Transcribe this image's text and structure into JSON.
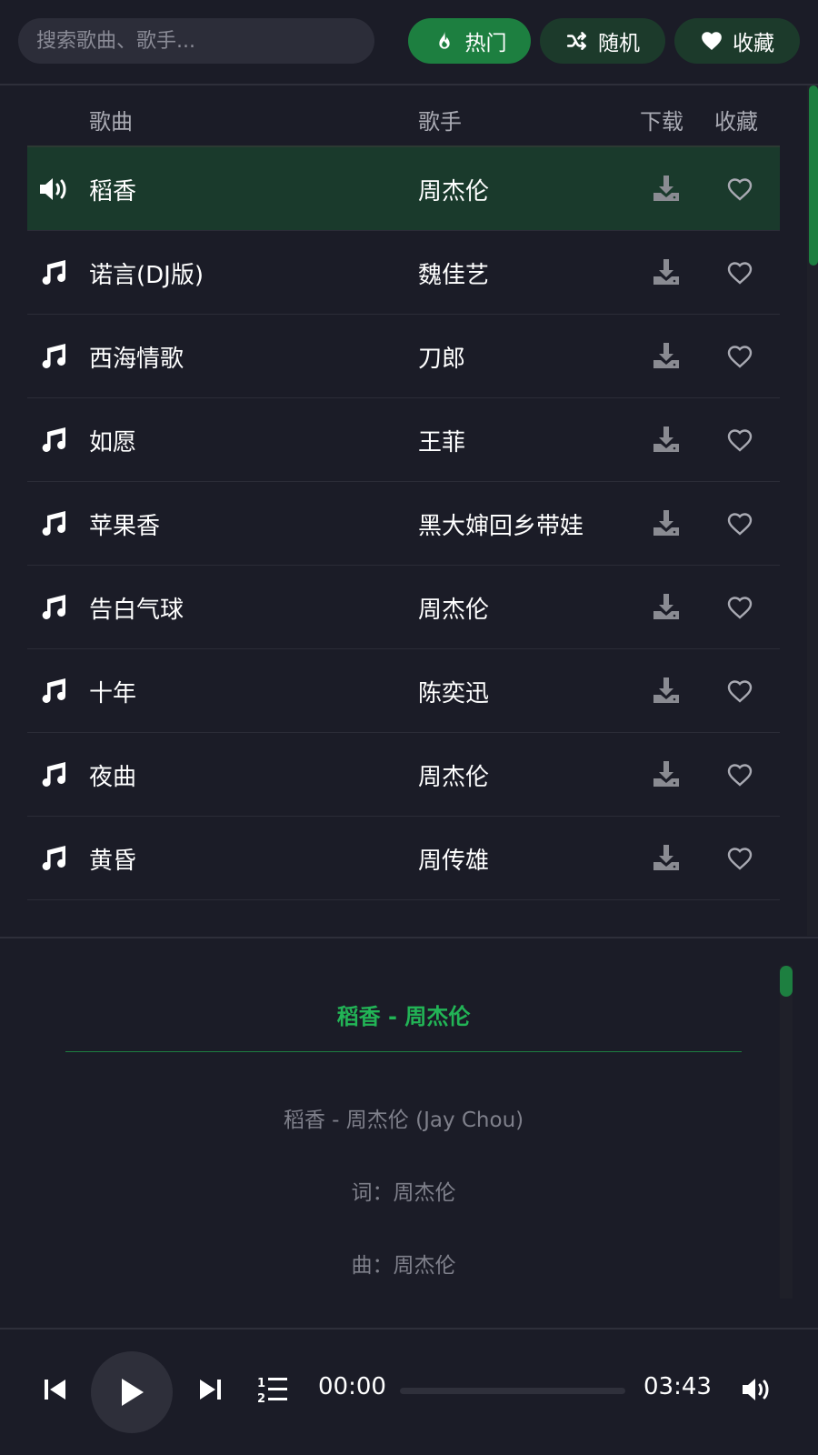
{
  "search": {
    "placeholder": "搜索歌曲、歌手..."
  },
  "toolbar": {
    "hot_label": "热门",
    "random_label": "随机",
    "favorites_label": "收藏"
  },
  "list": {
    "headers": {
      "song": "歌曲",
      "artist": "歌手",
      "download": "下载",
      "favorite": "收藏"
    },
    "rows": [
      {
        "song": "稻香",
        "artist": "周杰伦",
        "playing": true
      },
      {
        "song": "诺言(DJ版)",
        "artist": "魏佳艺",
        "playing": false
      },
      {
        "song": "西海情歌",
        "artist": "刀郎",
        "playing": false
      },
      {
        "song": "如愿",
        "artist": "王菲",
        "playing": false
      },
      {
        "song": "苹果香",
        "artist": "黑大婶回乡带娃",
        "playing": false
      },
      {
        "song": "告白气球",
        "artist": "周杰伦",
        "playing": false
      },
      {
        "song": "十年",
        "artist": "陈奕迅",
        "playing": false
      },
      {
        "song": "夜曲",
        "artist": "周杰伦",
        "playing": false
      },
      {
        "song": "黄昏",
        "artist": "周传雄",
        "playing": false
      }
    ]
  },
  "lyrics": {
    "title": "稻香 - 周杰伦",
    "lines": [
      "稻香 - 周杰伦 (Jay Chou)",
      "词：周杰伦",
      "曲：周杰伦"
    ]
  },
  "player": {
    "current_time": "00:00",
    "total_time": "03:43",
    "progress": 0
  },
  "colors": {
    "accent": "#1d7f40",
    "accent_text": "#22b456",
    "active_row": "#1a3a2c",
    "background": "#1b1c27"
  },
  "icons": {
    "hot": "flame-icon",
    "random": "shuffle-icon",
    "favorites": "heart-icon",
    "playing": "speaker-icon",
    "track": "music-note-icon",
    "download": "download-icon",
    "favorite": "heart-outline-icon",
    "prev": "skip-previous-icon",
    "play": "play-icon",
    "next": "skip-next-icon",
    "playlist": "ordered-list-icon",
    "volume": "volume-icon"
  }
}
